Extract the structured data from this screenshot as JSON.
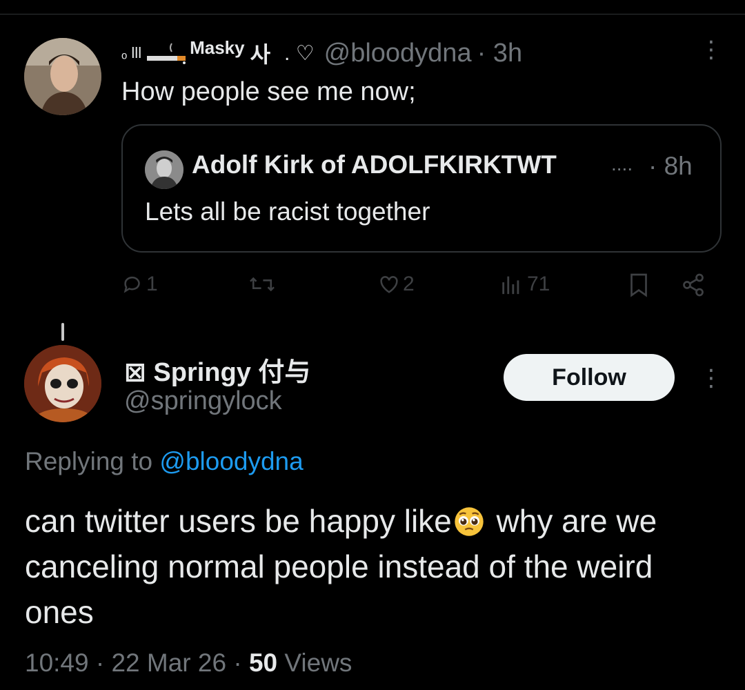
{
  "tweet1": {
    "display_name_deco": "ₒ lll",
    "display_name": "Masky",
    "display_name_suffix": "사",
    "name_extra": ". ♡",
    "handle": "@bloodydna",
    "time": "· 3h",
    "text": "How people see me now;",
    "quote": {
      "name": "Adolf Kirk of ADOLFKIRKTWT",
      "ellipsis": "....",
      "time": "· 8h",
      "text": "Lets all be racist together"
    },
    "actions": {
      "replies": "1",
      "likes": "2",
      "views": "71"
    }
  },
  "tweet2": {
    "name": "⊠ Springy 付与",
    "handle": "@springylock",
    "follow_label": "Follow",
    "replying_prefix": "Replying to",
    "replying_handle": "@bloodydna",
    "text_part1": "can twitter users be happy like",
    "text_part2": " why are we canceling normal people instead of the weird ones",
    "time": "10:49 · 22 Mar 26 · ",
    "views_count": "50",
    "views_label": " Views"
  },
  "colors": {
    "background": "#000000",
    "text": "#e7e9ea",
    "secondary": "#71767b",
    "link": "#1d9bf0",
    "follow_bg": "#eff3f4"
  }
}
